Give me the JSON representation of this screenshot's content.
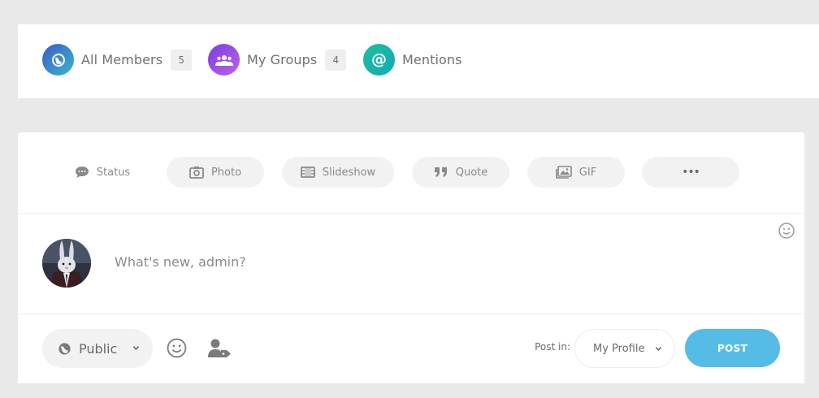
{
  "nav": {
    "items": [
      {
        "label": "All Members",
        "count": "5",
        "icon": "globe-icon"
      },
      {
        "label": "My Groups",
        "count": "4",
        "icon": "users-icon"
      },
      {
        "label": "Mentions",
        "icon": "at-sign-icon"
      }
    ]
  },
  "post_types": [
    {
      "label": "Status",
      "icon": "speech-bubble-icon"
    },
    {
      "label": "Photo",
      "icon": "camera-icon"
    },
    {
      "label": "Slideshow",
      "icon": "film-icon"
    },
    {
      "label": "Quote",
      "icon": "quote-icon"
    },
    {
      "label": "GIF",
      "icon": "image-icon"
    },
    {
      "label": "•••",
      "icon": "more-icon"
    }
  ],
  "composer": {
    "placeholder": "What's new, admin?"
  },
  "footer": {
    "privacy_label": "Public",
    "post_in_label": "Post in:",
    "target_label": "My Profile",
    "post_label": "POST"
  },
  "colors": {
    "accent": "#55bce6",
    "all_members_gradient": [
      "#3a5bd0",
      "#39b7c6"
    ],
    "my_groups_gradient": [
      "#7a3fe0",
      "#c05fe8"
    ],
    "mentions_gradient": [
      "#1fbe9c",
      "#12a9b8"
    ]
  }
}
